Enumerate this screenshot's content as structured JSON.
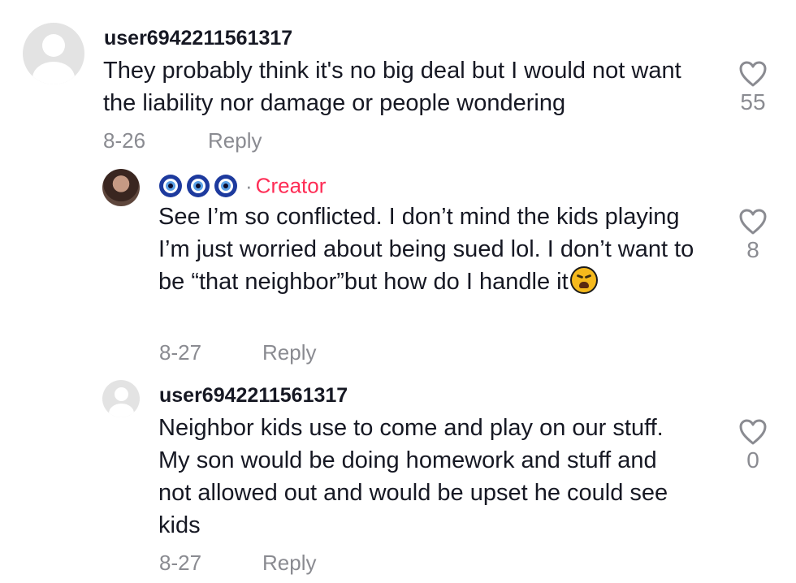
{
  "comments": [
    {
      "username": "user6942211561317",
      "text": "They probably think it's no big deal but I would not want the liability nor damage or people wondering",
      "date": "8-26",
      "reply_label": "Reply",
      "likes": "55",
      "avatar": "default-avatar"
    },
    {
      "username_emojis": [
        "nazar-amulet-icon",
        "nazar-amulet-icon",
        "nazar-amulet-icon"
      ],
      "separator": "·",
      "badge": "Creator",
      "text": "See I’m so conflicted. I don’t mind the kids playing I’m just worried about being sued lol. I don’t want to be “that neighbor”but how do I handle it",
      "trailing_emoji": "weary-face-icon",
      "date": "8-27",
      "reply_label": "Reply",
      "likes": "8",
      "avatar": "photo-avatar"
    },
    {
      "username": "user6942211561317",
      "text": "Neighbor kids use to come and play on our stuff. My son would be doing homework and stuff and not allowed out and would be upset he could see kids",
      "date": "8-27",
      "reply_label": "Reply",
      "likes": "0",
      "avatar": "default-avatar"
    }
  ],
  "colors": {
    "text": "#161823",
    "muted": "#8a8b91",
    "creator": "#fe2c55"
  },
  "icons": {
    "like": "heart-outline-icon"
  }
}
